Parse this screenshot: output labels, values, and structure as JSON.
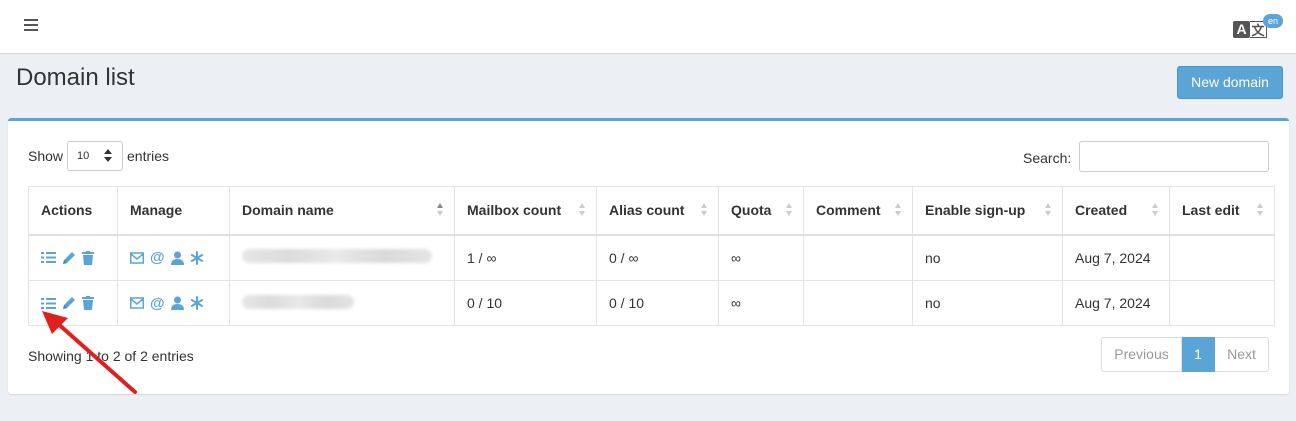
{
  "header": {
    "menu_icon": "hamburger-icon",
    "lang_icon": "translate-icon",
    "lang_a": "A",
    "lang_b": "文",
    "lang_badge": "en"
  },
  "page": {
    "title": "Domain list",
    "new_button": "New domain"
  },
  "controls": {
    "show_label": "Show",
    "entries_value": "10",
    "entries_label": "entries",
    "search_label": "Search:",
    "search_value": ""
  },
  "table": {
    "columns": [
      "Actions",
      "Manage",
      "Domain name",
      "Mailbox count",
      "Alias count",
      "Quota",
      "Comment",
      "Enable sign-up",
      "Created",
      "Last edit"
    ],
    "sorted_column": "Domain name",
    "action_icons": [
      "list-icon",
      "pencil-icon",
      "trash-icon"
    ],
    "manage_icons": [
      "envelope-icon",
      "at-icon",
      "user-icon",
      "asterisk-icon"
    ],
    "rows": [
      {
        "mailbox_count": "1 / ∞",
        "alias_count": "0 / ∞",
        "quota": "∞",
        "comment": "",
        "enable_signup": "no",
        "created": "Aug 7, 2024",
        "last_edit": ""
      },
      {
        "mailbox_count": "0 / 10",
        "alias_count": "0 / 10",
        "quota": "∞",
        "comment": "",
        "enable_signup": "no",
        "created": "Aug 7, 2024",
        "last_edit": ""
      }
    ]
  },
  "footer": {
    "showing_text": "Showing 1 to 2 of 2 entries",
    "prev_label": "Previous",
    "page_number": "1",
    "next_label": "Next"
  },
  "colors": {
    "accent": "#5ba4d6",
    "arrow": "#e01f1f"
  }
}
